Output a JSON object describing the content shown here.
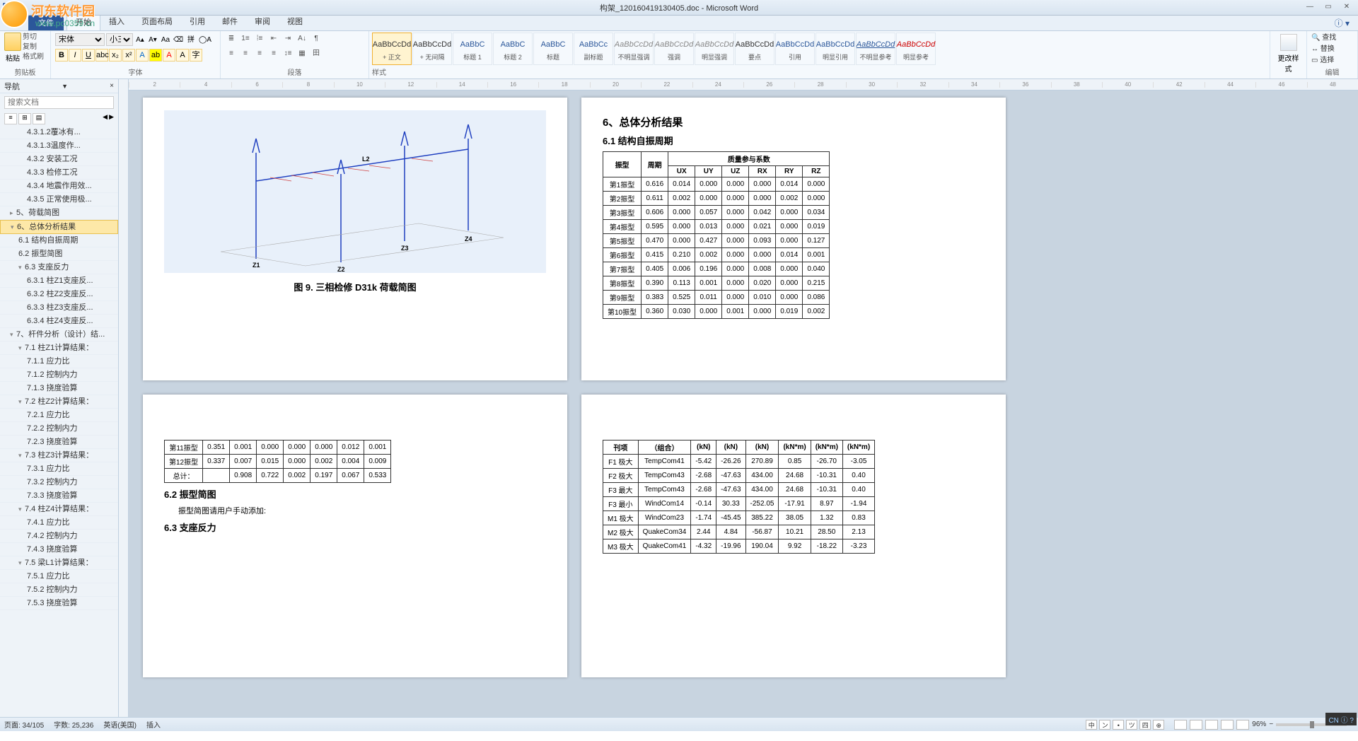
{
  "title": "构架_120160419130405.doc - Microsoft Word",
  "watermark": {
    "line1": "河东软件园",
    "line2": "www.pc0359.cn"
  },
  "ribbonTabs": {
    "file": "文件",
    "tabs": [
      "开始",
      "插入",
      "页面布局",
      "引用",
      "邮件",
      "审阅",
      "视图"
    ],
    "active": 0
  },
  "clipboard": {
    "paste": "粘贴",
    "cut": "剪切",
    "copy": "复制",
    "format": "格式刷",
    "label": "剪贴板"
  },
  "font": {
    "name": "宋体",
    "size": "小三",
    "label": "字体"
  },
  "para": {
    "label": "段落"
  },
  "stylesLabel": "样式",
  "styles": [
    {
      "preview": "AaBbCcDd",
      "name": "+ 正文",
      "sel": true
    },
    {
      "preview": "AaBbCcDd",
      "name": "+ 无间隔"
    },
    {
      "preview": "AaBbC",
      "name": "标题 1",
      "cls": "blue"
    },
    {
      "preview": "AaBbC",
      "name": "标题 2",
      "cls": "blue"
    },
    {
      "preview": "AaBbC",
      "name": "标题",
      "cls": "blue"
    },
    {
      "preview": "AaBbCc",
      "name": "副标题",
      "cls": "blue"
    },
    {
      "preview": "AaBbCcDd",
      "name": "不明显强调",
      "cls": "italic"
    },
    {
      "preview": "AaBbCcDd",
      "name": "强调",
      "cls": "italic"
    },
    {
      "preview": "AaBbCcDd",
      "name": "明显强调",
      "cls": "italic"
    },
    {
      "preview": "AaBbCcDd",
      "name": "要点"
    },
    {
      "preview": "AaBbCcDd",
      "name": "引用",
      "cls": "blue"
    },
    {
      "preview": "AaBbCcDd",
      "name": "明显引用",
      "cls": "blue"
    },
    {
      "preview": "AaBbCcDd",
      "name": "不明显参考",
      "cls": "underline"
    },
    {
      "preview": "AaBbCcDd",
      "name": "明显参考",
      "cls": "red"
    }
  ],
  "changeStyle": "更改样式",
  "edit": {
    "find": "查找",
    "replace": "替换",
    "select": "选择",
    "label": "编辑"
  },
  "nav": {
    "title": "导航",
    "searchPlaceholder": "搜索文档",
    "items": [
      {
        "t": "4.3.1.2覆冰有...",
        "l": 3
      },
      {
        "t": "4.3.1.3温度作...",
        "l": 3
      },
      {
        "t": "4.3.2 安装工况",
        "l": 3
      },
      {
        "t": "4.3.3 检修工况",
        "l": 3
      },
      {
        "t": "4.3.4 地震作用效...",
        "l": 3
      },
      {
        "t": "4.3.5 正常使用极...",
        "l": 3
      },
      {
        "t": "5、荷载简图",
        "l": 1,
        "a": "▸"
      },
      {
        "t": "6、总体分析结果",
        "l": 1,
        "sel": true,
        "a": "▾"
      },
      {
        "t": "6.1 结构自振周期",
        "l": 2
      },
      {
        "t": "6.2 振型简图",
        "l": 2
      },
      {
        "t": "6.3 支座反力",
        "l": 2,
        "a": "▾"
      },
      {
        "t": "6.3.1 柱Z1支座反...",
        "l": 3
      },
      {
        "t": "6.3.2 柱Z2支座反...",
        "l": 3
      },
      {
        "t": "6.3.3 柱Z3支座反...",
        "l": 3
      },
      {
        "t": "6.3.4 柱Z4支座反...",
        "l": 3
      },
      {
        "t": "7、杆件分析（设计）结...",
        "l": 1,
        "a": "▾"
      },
      {
        "t": "7.1 柱Z1计算结果：",
        "l": 2,
        "a": "▾"
      },
      {
        "t": "7.1.1 应力比",
        "l": 3
      },
      {
        "t": "7.1.2 控制内力",
        "l": 3
      },
      {
        "t": "7.1.3 挠度验算",
        "l": 3
      },
      {
        "t": "7.2 柱Z2计算结果：",
        "l": 2,
        "a": "▾"
      },
      {
        "t": "7.2.1 应力比",
        "l": 3
      },
      {
        "t": "7.2.2 控制内力",
        "l": 3
      },
      {
        "t": "7.2.3 挠度验算",
        "l": 3
      },
      {
        "t": "7.3 柱Z3计算结果：",
        "l": 2,
        "a": "▾"
      },
      {
        "t": "7.3.1 应力比",
        "l": 3
      },
      {
        "t": "7.3.2 控制内力",
        "l": 3
      },
      {
        "t": "7.3.3 挠度验算",
        "l": 3
      },
      {
        "t": "7.4 柱Z4计算结果：",
        "l": 2,
        "a": "▾"
      },
      {
        "t": "7.4.1 应力比",
        "l": 3
      },
      {
        "t": "7.4.2 控制内力",
        "l": 3
      },
      {
        "t": "7.4.3 挠度验算",
        "l": 3
      },
      {
        "t": "7.5 梁L1计算结果：",
        "l": 2,
        "a": "▾"
      },
      {
        "t": "7.5.1 应力比",
        "l": 3
      },
      {
        "t": "7.5.2 控制内力",
        "l": 3
      },
      {
        "t": "7.5.3 挠度验算",
        "l": 3
      }
    ]
  },
  "page1": {
    "caption": "图 9.  三相检修 D31k 荷载简图",
    "nodes": [
      "Z1",
      "Z2",
      "Z3",
      "Z4",
      "L2"
    ]
  },
  "page2": {
    "h6": "6、总体分析结果",
    "h61": "6.1 结构自振周期",
    "tbl_head": {
      "mode": "振型",
      "period": "周期",
      "mass": "质量参与系数",
      "UX": "UX",
      "UY": "UY",
      "UZ": "UZ",
      "RX": "RX",
      "RY": "RY",
      "RZ": "RZ"
    },
    "rows": [
      [
        "第1振型",
        "0.616",
        "0.014",
        "0.000",
        "0.000",
        "0.000",
        "0.014",
        "0.000"
      ],
      [
        "第2振型",
        "0.611",
        "0.002",
        "0.000",
        "0.000",
        "0.000",
        "0.002",
        "0.000"
      ],
      [
        "第3振型",
        "0.606",
        "0.000",
        "0.057",
        "0.000",
        "0.042",
        "0.000",
        "0.034"
      ],
      [
        "第4振型",
        "0.595",
        "0.000",
        "0.013",
        "0.000",
        "0.021",
        "0.000",
        "0.019"
      ],
      [
        "第5振型",
        "0.470",
        "0.000",
        "0.427",
        "0.000",
        "0.093",
        "0.000",
        "0.127"
      ],
      [
        "第6振型",
        "0.415",
        "0.210",
        "0.002",
        "0.000",
        "0.000",
        "0.014",
        "0.001"
      ],
      [
        "第7振型",
        "0.405",
        "0.006",
        "0.196",
        "0.000",
        "0.008",
        "0.000",
        "0.040"
      ],
      [
        "第8振型",
        "0.390",
        "0.113",
        "0.001",
        "0.000",
        "0.020",
        "0.000",
        "0.215"
      ],
      [
        "第9振型",
        "0.383",
        "0.525",
        "0.011",
        "0.000",
        "0.010",
        "0.000",
        "0.086"
      ],
      [
        "第10振型",
        "0.360",
        "0.030",
        "0.000",
        "0.001",
        "0.000",
        "0.019",
        "0.002"
      ]
    ]
  },
  "page3": {
    "h62": "6.2 振型简图",
    "note62": "振型简图请用户手动添加:",
    "h63": "6.3 支座反力",
    "total": "总计：",
    "rows": [
      [
        "第11振型",
        "0.351",
        "0.001",
        "0.000",
        "0.000",
        "0.000",
        "0.012",
        "0.001"
      ],
      [
        "第12振型",
        "0.337",
        "0.007",
        "0.015",
        "0.000",
        "0.002",
        "0.004",
        "0.009"
      ],
      [
        "总计：",
        "",
        "0.908",
        "0.722",
        "0.002",
        "0.197",
        "0.067",
        "0.533"
      ]
    ]
  },
  "page4": {
    "head": [
      "刊项",
      "（组合）",
      "(kN)",
      "(kN)",
      "(kN)",
      "(kN*m)",
      "(kN*m)",
      "(kN*m)"
    ],
    "rows": [
      [
        "F1 极大",
        "TempCom41",
        "-5.42",
        "-26.26",
        "270.89",
        "0.85",
        "-26.70",
        "-3.05"
      ],
      [
        "F2 极大",
        "TempCom43",
        "-2.68",
        "-47.63",
        "434.00",
        "24.68",
        "-10.31",
        "0.40"
      ],
      [
        "F3 最大",
        "TempCom43",
        "-2.68",
        "-47.63",
        "434.00",
        "24.68",
        "-10.31",
        "0.40"
      ],
      [
        "F3 最小",
        "WindCom14",
        "-0.14",
        "30.33",
        "-252.05",
        "-17.91",
        "8.97",
        "-1.94"
      ],
      [
        "M1 极大",
        "WindCom23",
        "-1.74",
        "-45.45",
        "385.22",
        "38.05",
        "1.32",
        "0.83"
      ],
      [
        "M2 极大",
        "QuakeCom34",
        "2.44",
        "4.84",
        "-56.87",
        "10.21",
        "28.50",
        "2.13"
      ],
      [
        "M3 极大",
        "QuakeCom41",
        "-4.32",
        "-19.96",
        "190.04",
        "9.92",
        "-18.22",
        "-3.23"
      ]
    ]
  },
  "status": {
    "page": "页面: 34/105",
    "words": "字数: 25,236",
    "lang": "英语(美国)",
    "ins": "插入",
    "zoom": "96%",
    "tray": [
      "中",
      "ン",
      "•",
      "ツ",
      "四",
      "⊕"
    ]
  },
  "ime": "CN ⓘ ?"
}
